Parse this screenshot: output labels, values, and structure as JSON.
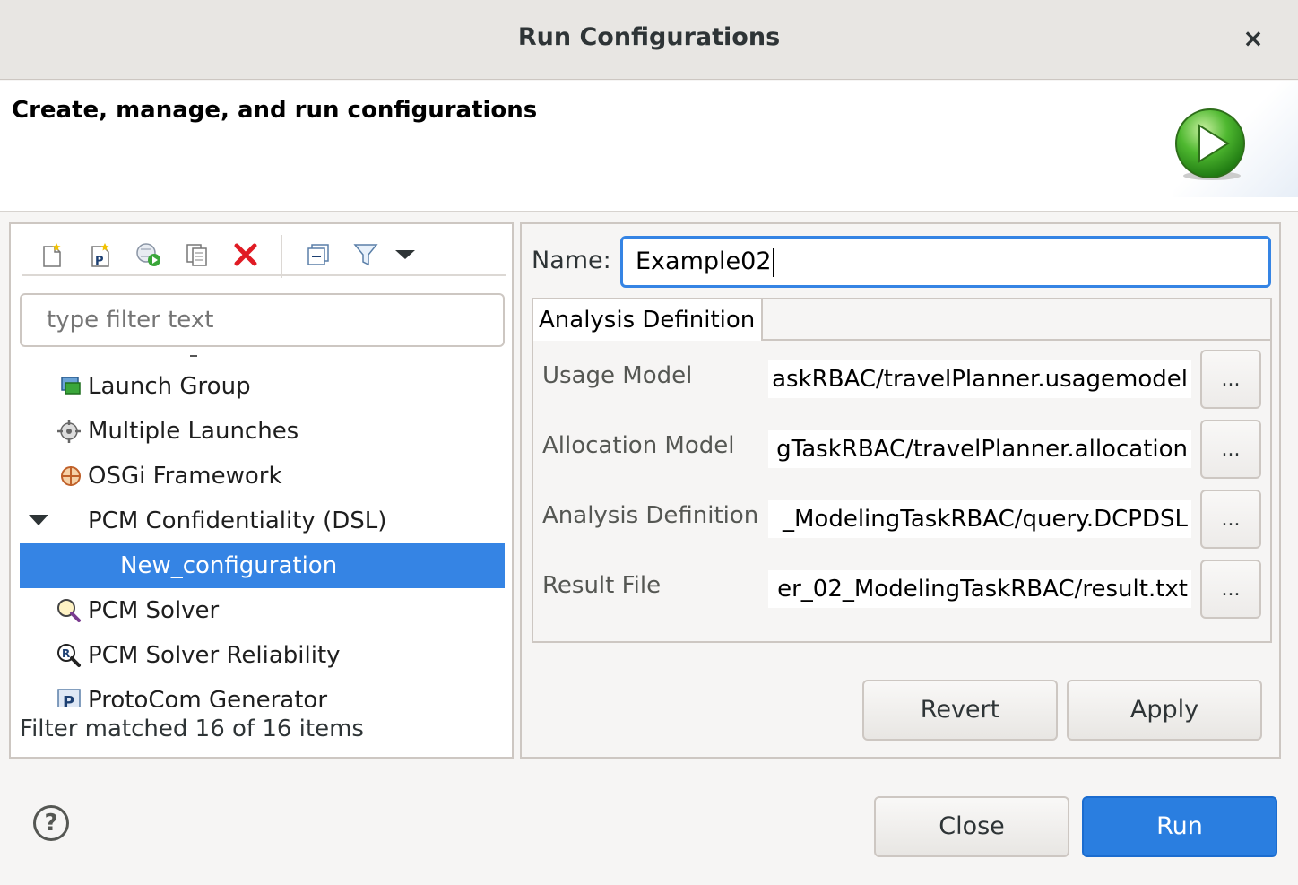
{
  "window": {
    "title": "Run Configurations",
    "close_glyph": "×"
  },
  "header": {
    "heading": "Create, manage, and run configurations",
    "icon": "run-icon"
  },
  "toolbar": {
    "icons": [
      "new-configuration-icon",
      "new-prototype-icon",
      "export-icon",
      "duplicate-icon",
      "delete-icon",
      "collapse-all-icon",
      "filter-icon",
      "view-menu-icon"
    ]
  },
  "filter": {
    "placeholder": "type filter text"
  },
  "tree": {
    "items": [
      {
        "label": "Launch Group",
        "icon": "launch-group-icon"
      },
      {
        "label": "Multiple Launches",
        "icon": "multiple-launches-icon"
      },
      {
        "label": "OSGi Framework",
        "icon": "osgi-icon"
      },
      {
        "label": "PCM Confidentiality (DSL)",
        "expanded": true
      },
      {
        "label": "New_configuration",
        "selected": true
      },
      {
        "label": "PCM Solver",
        "icon": "pcm-solver-icon"
      },
      {
        "label": "PCM Solver Reliability",
        "icon": "pcm-reliability-icon"
      },
      {
        "label": "ProtoCom Generator",
        "icon": "protocom-icon"
      }
    ]
  },
  "status": "Filter matched 16 of 16 items",
  "config": {
    "name_label": "Name:",
    "name_value": "Example02",
    "tab_label": "Analysis Definition",
    "fields": [
      {
        "label": "Usage Model",
        "value": "askRBAC/travelPlanner.usagemodel",
        "button": "..."
      },
      {
        "label": "Allocation Model",
        "value": "gTaskRBAC/travelPlanner.allocation",
        "button": "..."
      },
      {
        "label": "Analysis Definition",
        "value": "_ModelingTaskRBAC/query.DCPDSL",
        "button": "..."
      },
      {
        "label": "Result File",
        "value": "er_02_ModelingTaskRBAC/result.txt",
        "button": "..."
      }
    ],
    "revert_label": "Revert",
    "apply_label": "Apply"
  },
  "footer": {
    "help_glyph": "?",
    "close_label": "Close",
    "run_label": "Run"
  },
  "colors": {
    "accent": "#3584e4",
    "run_button": "#2a7ee0",
    "delete_icon": "#e01b24"
  }
}
